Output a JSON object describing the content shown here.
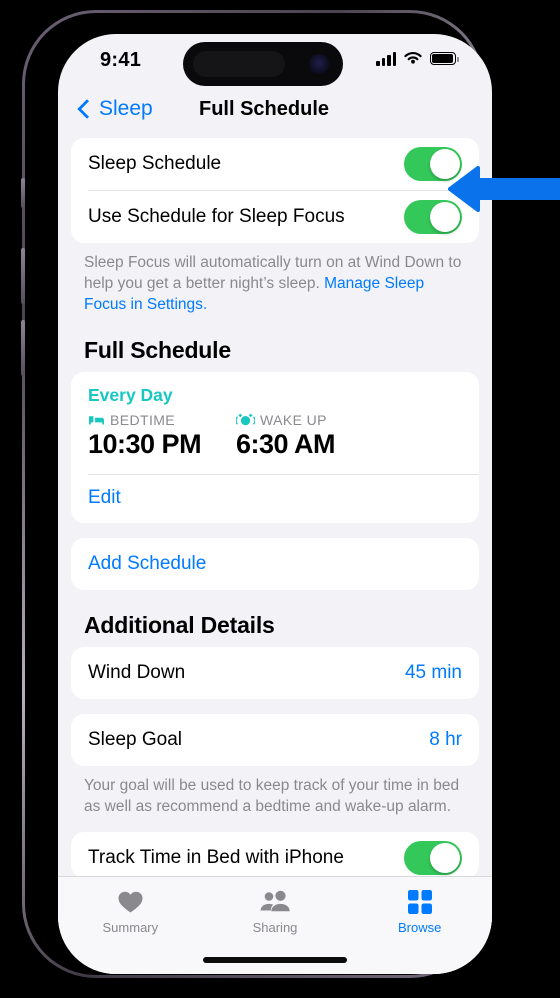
{
  "status_bar": {
    "time": "9:41",
    "cellular_icon": "cellular-bars-icon",
    "wifi_icon": "wifi-icon",
    "battery_icon": "battery-icon"
  },
  "nav": {
    "back_label": "Sleep",
    "back_icon": "chevron-left-icon",
    "title": "Full Schedule"
  },
  "toggles_card": {
    "rows": [
      {
        "label": "Sleep Schedule",
        "state": "on"
      },
      {
        "label": "Use Schedule for Sleep Focus",
        "state": "on"
      }
    ],
    "footnote_part1": "Sleep Focus will automatically turn on at Wind Down to help you get a better night’s sleep. ",
    "footnote_link": "Manage Sleep Focus in Settings."
  },
  "full_schedule": {
    "section_title": "Full Schedule",
    "day_label": "Every Day",
    "bedtime_icon": "bed-icon",
    "bedtime_caption": "BEDTIME",
    "bedtime_value": "10:30 PM",
    "wakeup_icon": "alarm-clock-icon",
    "wakeup_caption": "WAKE UP",
    "wakeup_value": "6:30 AM",
    "edit_label": "Edit",
    "add_schedule_label": "Add Schedule"
  },
  "additional_details": {
    "section_title": "Additional Details",
    "wind_down": {
      "label": "Wind Down",
      "value": "45 min"
    },
    "sleep_goal": {
      "label": "Sleep Goal",
      "value": "8 hr"
    },
    "sleep_goal_footnote": "Your goal will be used to keep track of your time in bed as well as recommend a bedtime and wake-up alarm.",
    "track_time": {
      "label": "Track Time in Bed with iPhone",
      "state": "on"
    }
  },
  "tab_bar": {
    "tabs": [
      {
        "label": "Summary",
        "icon": "heart-icon",
        "active": false
      },
      {
        "label": "Sharing",
        "icon": "people-icon",
        "active": false
      },
      {
        "label": "Browse",
        "icon": "grid-squares-icon",
        "active": true
      }
    ]
  },
  "annotation": {
    "arrow_icon": "left-arrow-annotation",
    "color": "#0a72ea"
  },
  "colors": {
    "accent_blue": "#007aff",
    "toggle_green": "#34c759",
    "teal": "#17c7c0",
    "page_background": "#f2f2f7",
    "card_background": "#ffffff"
  }
}
